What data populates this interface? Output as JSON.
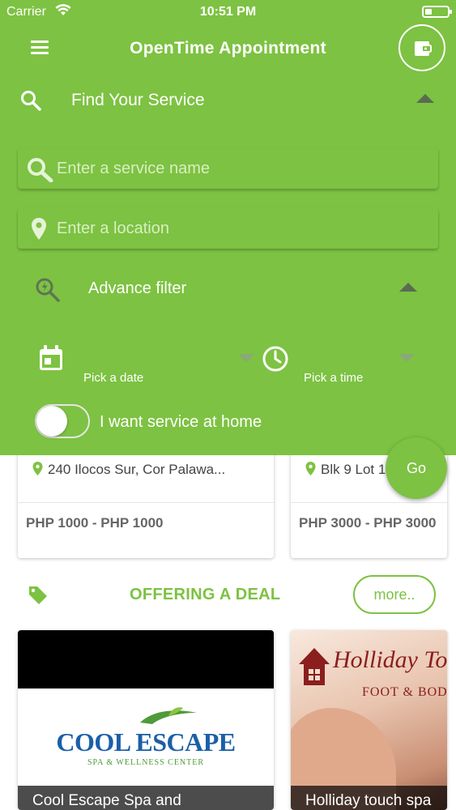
{
  "status_bar": {
    "carrier": "Carrier",
    "time": "10:51 PM"
  },
  "header": {
    "title": "OpenTime Appointment"
  },
  "search": {
    "section_label": "Find Your Service",
    "service_placeholder": "Enter a service name",
    "location_placeholder": "Enter a location"
  },
  "advance_filter": {
    "label": "Advance filter",
    "date_label": "Pick a date",
    "time_label": "Pick a time",
    "home_service_label": "I want service at home",
    "home_service_on": false
  },
  "listings": [
    {
      "address": "240 Ilocos Sur, Cor Palawa...",
      "price": "PHP 1000 - PHP 1000"
    },
    {
      "address": "Blk 9 Lot 1",
      "price": "PHP 3000 - PHP 3000"
    }
  ],
  "go_button": "Go",
  "deals": {
    "title": "OFFERING A DEAL",
    "more_label": "more..",
    "items": [
      {
        "name": "Cool Escape Spa and",
        "logo_main": "COOL ESCAPE",
        "logo_sub": "SPA & WELLNESS CENTER"
      },
      {
        "name": "Holliday touch spa",
        "logo_main": "Holliday To",
        "logo_sub": "FOOT & BODY"
      }
    ]
  },
  "colors": {
    "primary": "#7dc242",
    "text_gray": "#666666",
    "deal_logo_blue": "#1b5fa8"
  },
  "icons": [
    "wifi-icon",
    "battery-icon",
    "menu-icon",
    "wallet-icon",
    "search-icon",
    "location-pin-icon",
    "filter-icon",
    "calendar-icon",
    "clock-icon",
    "tag-icon",
    "chevron-up-icon",
    "chevron-down-icon"
  ]
}
